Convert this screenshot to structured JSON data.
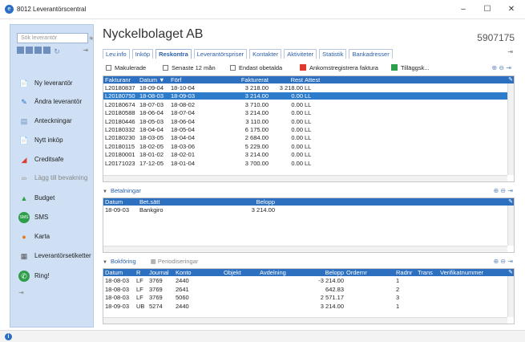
{
  "window": {
    "title": "8012 Leverantörscentral",
    "minimize": "–",
    "maximize": "☐",
    "close": "✕"
  },
  "sidebar": {
    "search_placeholder": "Sök leverantör",
    "items": [
      {
        "label": "Ny leverantör",
        "icon": "new-supplier-icon"
      },
      {
        "label": "Ändra leverantör",
        "icon": "edit-supplier-icon"
      },
      {
        "label": "Anteckningar",
        "icon": "notes-icon"
      },
      {
        "label": "Nytt inköp",
        "icon": "new-purchase-icon"
      },
      {
        "label": "Creditsafe",
        "icon": "creditsafe-icon"
      },
      {
        "label": "Lägg till bevakning",
        "icon": "watch-icon"
      },
      {
        "label": "Budget",
        "icon": "budget-icon"
      },
      {
        "label": "SMS",
        "icon": "sms-icon"
      },
      {
        "label": "Karta",
        "icon": "map-pin-icon"
      },
      {
        "label": "Leverantörsetiketter",
        "icon": "labels-icon"
      },
      {
        "label": "Ring!",
        "icon": "phone-icon"
      }
    ]
  },
  "header": {
    "company": "Nyckelbolaget AB",
    "org_number": "5907175"
  },
  "tabs": [
    "Lev.info",
    "Inköp",
    "Reskontra",
    "Leverantörspriser",
    "Kontakter",
    "Aktiviteter",
    "Statistik",
    "Bankadresser"
  ],
  "active_tab": "Reskontra",
  "toolbar": {
    "makulerade": "Makulerade",
    "senaste12": "Senaste 12 mån",
    "endast": "Endast obetalda",
    "ankomst": "Ankomstregistrera faktura",
    "tillagg": "Tilläggsk..."
  },
  "invoices": {
    "columns": [
      "Fakturanr",
      "Datum ▼",
      "Förf",
      "Fakturerat",
      "Rest",
      "Attest"
    ],
    "rows": [
      [
        "L20180837",
        "18-09-04",
        "18-10-04",
        "3 218.00",
        "3 218.00",
        "LL"
      ],
      [
        "L20180750",
        "18-08-03",
        "18-09-03",
        "3 214.00",
        "0.00",
        "LL"
      ],
      [
        "L20180674",
        "18-07-03",
        "18-08-02",
        "3 710.00",
        "0.00",
        "LL"
      ],
      [
        "L20180588",
        "18-06-04",
        "18-07-04",
        "3 214.00",
        "0.00",
        "LL"
      ],
      [
        "L20180446",
        "18-05-03",
        "18-06-04",
        "3 110.00",
        "0.00",
        "LL"
      ],
      [
        "L20180332",
        "18-04-04",
        "18-05-04",
        "6 175.00",
        "0.00",
        "LL"
      ],
      [
        "L20180230",
        "18-03-05",
        "18-04-04",
        "2 684.00",
        "0.00",
        "LL"
      ],
      [
        "L20180115",
        "18-02-05",
        "18-03-06",
        "5 229.00",
        "0.00",
        "LL"
      ],
      [
        "L20180001",
        "18-01-02",
        "18-02-01",
        "3 214.00",
        "0.00",
        "LL"
      ],
      [
        "L20171023",
        "17-12-05",
        "18-01-04",
        "3 700.00",
        "0.00",
        "LL"
      ]
    ],
    "selected_row": 1
  },
  "payments": {
    "title": "Betalningar",
    "columns": [
      "Datum",
      "Bet.sätt",
      "Belopp"
    ],
    "rows": [
      [
        "18-09-03",
        "Bankgiro",
        "3 214.00"
      ]
    ]
  },
  "bookkeeping": {
    "title": "Bokföring",
    "tab2": "Periodiseringar",
    "columns": [
      "Datum",
      "R",
      "Journal",
      "Konto",
      "Objekt",
      "Avdelning",
      "Belopp",
      "Ordernr",
      "Radnr",
      "Trans",
      "Verifikatnummer"
    ],
    "rows": [
      [
        "18-08-03",
        "LF",
        "3769",
        "2440",
        "",
        "",
        "-3 214.00",
        "",
        "1",
        "",
        ""
      ],
      [
        "18-08-03",
        "LF",
        "3769",
        "2641",
        "",
        "",
        "642.83",
        "",
        "2",
        "",
        ""
      ],
      [
        "18-08-03",
        "LF",
        "3769",
        "5060",
        "",
        "",
        "2 571.17",
        "",
        "3",
        "",
        ""
      ],
      [
        "18-09-03",
        "UB",
        "5274",
        "2440",
        "",
        "",
        "3 214.00",
        "",
        "1",
        "",
        ""
      ]
    ]
  }
}
